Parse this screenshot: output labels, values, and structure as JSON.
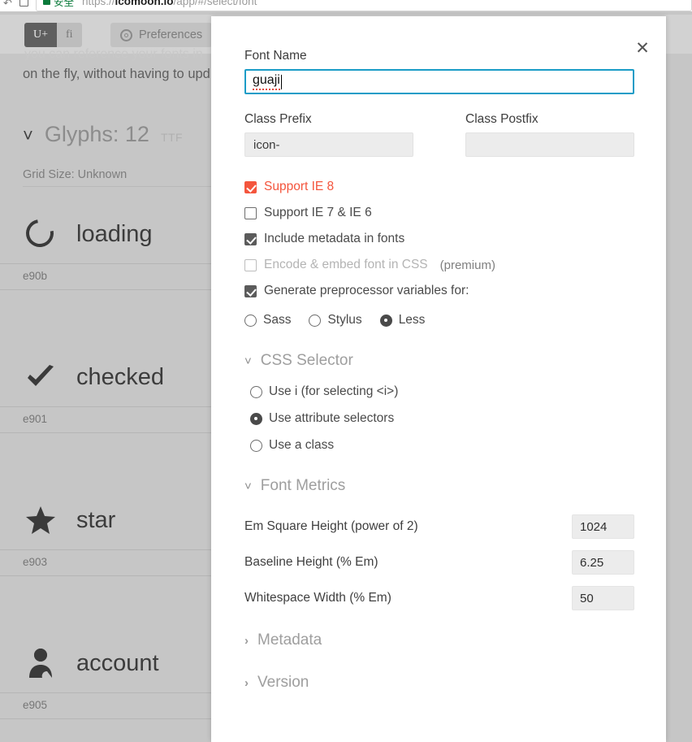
{
  "browser": {
    "back_icon": "back-arrow-icon",
    "tab_icon": "tab-icon",
    "secure_label": "安全",
    "url_host": "icomoon.io",
    "url_scheme": "https://",
    "url_path": "/app/#/select/font"
  },
  "app": {
    "toolbar": {
      "unicode_button": "U+",
      "ligature_button": "fi",
      "preferences_button": "Preferences"
    },
    "ghost_line": "you can reference your fonts in",
    "lead_text": "on the fly, without having to upd",
    "glyphs_header": {
      "title": "Glyphs: 12",
      "format_badge": "TTF",
      "grid_size": "Grid Size: Unknown"
    },
    "glyphs": [
      {
        "name": "loading",
        "code": "e90b",
        "icon": "loading-spinner-icon"
      },
      {
        "name": "checked",
        "code": "e901",
        "icon": "checkmark-icon"
      },
      {
        "name": "star",
        "code": "e903",
        "icon": "star-icon"
      },
      {
        "name": "account",
        "code": "e905",
        "icon": "account-person-icon"
      }
    ]
  },
  "modal": {
    "close_label": "✕",
    "font_name": {
      "label": "Font Name",
      "value": "guaji"
    },
    "class_prefix": {
      "label": "Class Prefix",
      "value": "icon-"
    },
    "class_postfix": {
      "label": "Class Postfix",
      "value": ""
    },
    "checkboxes": [
      {
        "label": "Support IE 8",
        "checked": true,
        "style": "red"
      },
      {
        "label": "Support IE 7 & IE 6",
        "checked": false,
        "style": "normal"
      },
      {
        "label": "Include metadata in fonts",
        "checked": true,
        "style": "normal"
      },
      {
        "label": "Encode & embed font in CSS",
        "checked": false,
        "style": "muted",
        "note": "(premium)"
      },
      {
        "label": "Generate preprocessor variables for:",
        "checked": true,
        "style": "normal"
      }
    ],
    "preprocessor_radios": [
      {
        "label": "Sass",
        "selected": false
      },
      {
        "label": "Stylus",
        "selected": false
      },
      {
        "label": "Less",
        "selected": true
      }
    ],
    "css_selector": {
      "title": "CSS Selector",
      "expanded": true,
      "options": [
        {
          "label": "Use i (for selecting <i>)",
          "selected": false
        },
        {
          "label": "Use attribute selectors",
          "selected": true
        },
        {
          "label": "Use a class",
          "selected": false
        }
      ]
    },
    "font_metrics": {
      "title": "Font Metrics",
      "expanded": true,
      "rows": [
        {
          "label": "Em Square Height (power of 2)",
          "value": "1024"
        },
        {
          "label": "Baseline Height (% Em)",
          "value": "6.25"
        },
        {
          "label": "Whitespace Width (% Em)",
          "value": "50"
        }
      ]
    },
    "metadata_section": {
      "title": "Metadata",
      "expanded": false
    },
    "version_section": {
      "title": "Version",
      "expanded": false
    }
  },
  "colors": {
    "accent_blue": "#1a9cc7",
    "alert_red": "#f4553d",
    "secure_green": "#0b7a3b",
    "page_bg": "#c6c6c6"
  }
}
